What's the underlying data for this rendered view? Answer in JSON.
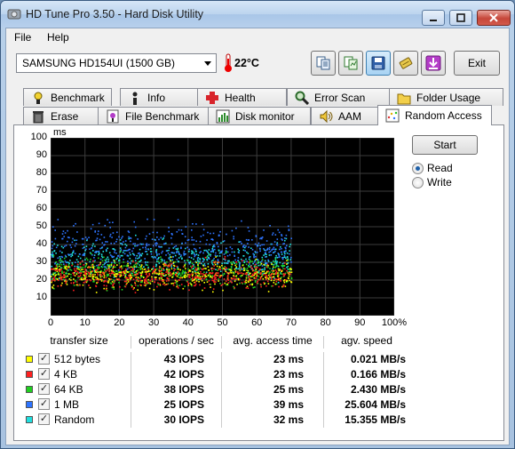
{
  "window": {
    "title": "HD Tune Pro 3.50 - Hard Disk Utility"
  },
  "menu": [
    "File",
    "Help"
  ],
  "drive": {
    "selected": "SAMSUNG HD154UI (1500 GB)",
    "temperature": "22°C"
  },
  "toolbar": {
    "exit_label": "Exit",
    "icons": [
      "copy-info-icon",
      "save-results-icon",
      "disk-save-icon",
      "options-icon",
      "minimize-tray-icon"
    ]
  },
  "tabs_row1": [
    {
      "label": "Benchmark",
      "icon": "benchmark-icon"
    },
    {
      "label": "Info",
      "icon": "info-icon"
    },
    {
      "label": "Health",
      "icon": "health-cross-icon"
    },
    {
      "label": "Error Scan",
      "icon": "magnifier-icon"
    },
    {
      "label": "Folder Usage",
      "icon": "folder-icon"
    }
  ],
  "tabs_row2": [
    {
      "label": "Erase",
      "icon": "trash-icon"
    },
    {
      "label": "File Benchmark",
      "icon": "file-benchmark-icon"
    },
    {
      "label": "Disk monitor",
      "icon": "disk-monitor-icon"
    },
    {
      "label": "AAM",
      "icon": "speaker-icon"
    },
    {
      "label": "Random Access",
      "icon": "random-access-icon"
    }
  ],
  "active_tab": "Random Access",
  "controls": {
    "start_label": "Start",
    "read_label": "Read",
    "write_label": "Write",
    "mode_selected": "Read"
  },
  "chart_data": {
    "type": "scatter",
    "ylabel": "ms",
    "ylim": [
      0,
      100
    ],
    "xlim": [
      0,
      100
    ],
    "y_ticks": [
      "10",
      "20",
      "30",
      "40",
      "50",
      "60",
      "70",
      "80",
      "90",
      "100"
    ],
    "x_ticks": [
      "0",
      "10",
      "20",
      "30",
      "40",
      "50",
      "60",
      "70",
      "80",
      "90",
      "100%"
    ],
    "grid": true,
    "series": [
      {
        "name": "512 bytes",
        "color": "#ffff00",
        "x_range": [
          0,
          70
        ],
        "y_center": 23
      },
      {
        "name": "4 KB",
        "color": "#ff2020",
        "x_range": [
          0,
          70
        ],
        "y_center": 23
      },
      {
        "name": "64 KB",
        "color": "#20d020",
        "x_range": [
          0,
          70
        ],
        "y_center": 25
      },
      {
        "name": "1 MB",
        "color": "#2e74ff",
        "x_range": [
          0,
          70
        ],
        "y_center": 39
      },
      {
        "name": "Random",
        "color": "#20e0e0",
        "x_range": [
          0,
          70
        ],
        "y_center": 32
      }
    ]
  },
  "results": {
    "headers": [
      "transfer size",
      "operations / sec",
      "avg. access time",
      "agv. speed"
    ],
    "rows": [
      {
        "name": "512 bytes",
        "color": "#ffff00",
        "checked": "✓",
        "iops": "43 IOPS",
        "access": "23 ms",
        "speed": "0.021 MB/s"
      },
      {
        "name": "4 KB",
        "color": "#ff2020",
        "checked": "✓",
        "iops": "42 IOPS",
        "access": "23 ms",
        "speed": "0.166 MB/s"
      },
      {
        "name": "64 KB",
        "color": "#20d020",
        "checked": "✓",
        "iops": "38 IOPS",
        "access": "25 ms",
        "speed": "2.430 MB/s"
      },
      {
        "name": "1 MB",
        "color": "#2e74ff",
        "checked": "✓",
        "iops": "25 IOPS",
        "access": "39 ms",
        "speed": "25.604 MB/s"
      },
      {
        "name": "Random",
        "color": "#20e0e0",
        "checked": "✓",
        "iops": "30 IOPS",
        "access": "32 ms",
        "speed": "15.355 MB/s"
      }
    ]
  }
}
